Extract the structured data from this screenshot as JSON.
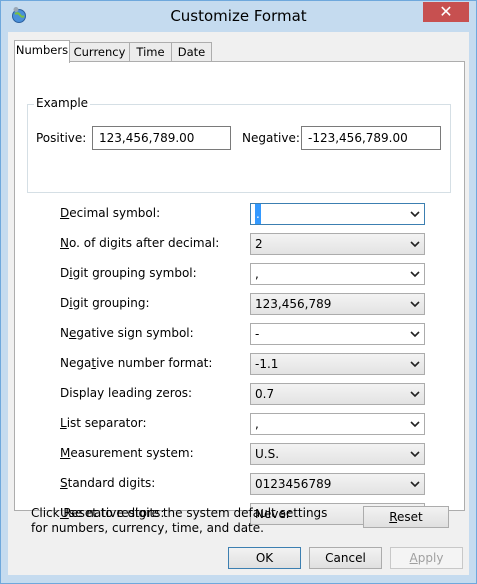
{
  "window": {
    "title": "Customize Format",
    "close_label": "✕"
  },
  "tabs": [
    {
      "label": "Numbers"
    },
    {
      "label": "Currency"
    },
    {
      "label": "Time"
    },
    {
      "label": "Date"
    }
  ],
  "example": {
    "legend": "Example",
    "positive_label": "Positive:",
    "positive_value": "123,456,789.00",
    "negative_label": "Negative:",
    "negative_value": "-123,456,789.00"
  },
  "settings": [
    {
      "mnemonic": "D",
      "rest": "ecimal symbol:",
      "value": ".",
      "editable": true
    },
    {
      "mnemonic": "N",
      "rest": "o. of digits after decimal:",
      "value": "2",
      "editable": false
    },
    {
      "prefix": "D",
      "mnemonic": "i",
      "rest": "git grouping symbol:",
      "value": ",",
      "editable": true
    },
    {
      "prefix": "D",
      "mnemonic": "i",
      "rest": "git grouping:",
      "value": "123,456,789",
      "editable": false
    },
    {
      "prefix": "N",
      "mnemonic": "e",
      "rest": "gative sign symbol:",
      "value": "-",
      "editable": true
    },
    {
      "prefix": "Nega",
      "mnemonic": "t",
      "rest": "ive number format:",
      "value": "-1.1",
      "editable": false
    },
    {
      "prefix": "Display leading zeros:",
      "mnemonic": "",
      "rest": "",
      "value": "0.7",
      "editable": false
    },
    {
      "mnemonic": "L",
      "rest": "ist separator:",
      "value": ",",
      "editable": true
    },
    {
      "mnemonic": "M",
      "rest": "easurement system:",
      "value": "U.S.",
      "editable": false
    },
    {
      "mnemonic": "S",
      "rest": "tandard digits:",
      "value": "0123456789",
      "editable": false
    },
    {
      "mnemonic": "U",
      "rest": "se native digits:",
      "value": "Never",
      "editable": false
    }
  ],
  "note": "Click Reset to restore the system default settings for numbers, currency, time, and date.",
  "buttons": {
    "reset": {
      "mnemonic": "R",
      "rest": "eset"
    },
    "ok": "OK",
    "cancel": "Cancel",
    "apply": {
      "mnemonic": "A",
      "rest": "pply"
    }
  }
}
